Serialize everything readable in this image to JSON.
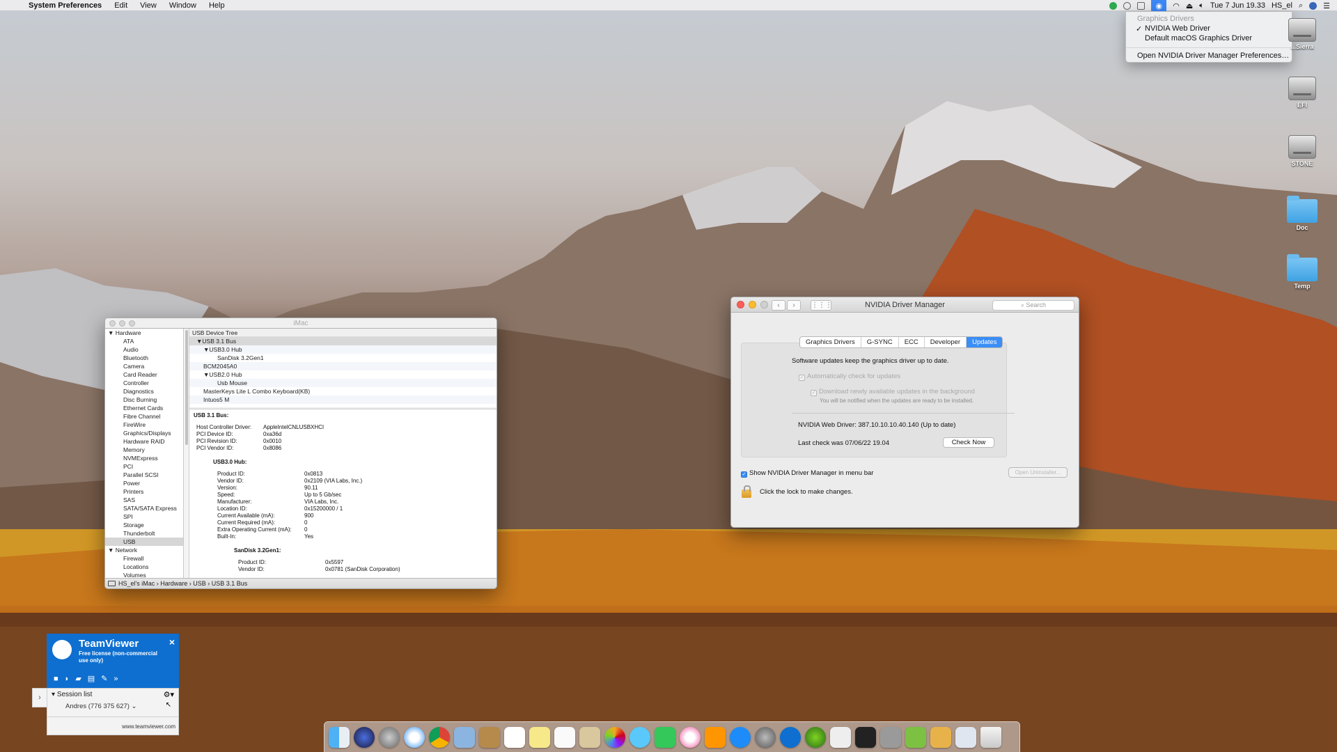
{
  "menubar": {
    "app": "System Preferences",
    "menus": [
      "Edit",
      "View",
      "Window",
      "Help"
    ],
    "clock": "Tue 7 Jun  19.33",
    "user": "HS_el"
  },
  "nvidia_menu": {
    "header": "Graphics Drivers",
    "checkmark": "✓",
    "option1": "NVIDIA Web Driver",
    "option2": "Default macOS Graphics Driver",
    "prefs": "Open NVIDIA Driver Manager Preferences…"
  },
  "desktop": {
    "icons": [
      "...Sierra",
      "EFI",
      "STONE",
      "Doc",
      "Temp"
    ]
  },
  "sysinfo": {
    "title": "iMac",
    "sidebar": [
      {
        "label": "Hardware",
        "type": "cat"
      },
      {
        "label": "ATA",
        "type": "sub"
      },
      {
        "label": "Audio",
        "type": "sub"
      },
      {
        "label": "Bluetooth",
        "type": "sub"
      },
      {
        "label": "Camera",
        "type": "sub"
      },
      {
        "label": "Card Reader",
        "type": "sub"
      },
      {
        "label": "Controller",
        "type": "sub"
      },
      {
        "label": "Diagnostics",
        "type": "sub"
      },
      {
        "label": "Disc Burning",
        "type": "sub"
      },
      {
        "label": "Ethernet Cards",
        "type": "sub"
      },
      {
        "label": "Fibre Channel",
        "type": "sub"
      },
      {
        "label": "FireWire",
        "type": "sub"
      },
      {
        "label": "Graphics/Displays",
        "type": "sub"
      },
      {
        "label": "Hardware RAID",
        "type": "sub"
      },
      {
        "label": "Memory",
        "type": "sub"
      },
      {
        "label": "NVMExpress",
        "type": "sub"
      },
      {
        "label": "PCI",
        "type": "sub"
      },
      {
        "label": "Parallel SCSI",
        "type": "sub"
      },
      {
        "label": "Power",
        "type": "sub"
      },
      {
        "label": "Printers",
        "type": "sub"
      },
      {
        "label": "SAS",
        "type": "sub"
      },
      {
        "label": "SATA/SATA Express",
        "type": "sub"
      },
      {
        "label": "SPI",
        "type": "sub"
      },
      {
        "label": "Storage",
        "type": "sub"
      },
      {
        "label": "Thunderbolt",
        "type": "sub"
      },
      {
        "label": "USB",
        "type": "sub",
        "selected": true
      },
      {
        "label": "Network",
        "type": "cat"
      },
      {
        "label": "Firewall",
        "type": "sub"
      },
      {
        "label": "Locations",
        "type": "sub"
      },
      {
        "label": "Volumes",
        "type": "sub"
      }
    ],
    "tree_header": "USB Device Tree",
    "tree": [
      {
        "label": "▼USB 3.1 Bus",
        "indent": 1,
        "selected": true
      },
      {
        "label": "▼USB3.0 Hub",
        "indent": 2
      },
      {
        "label": "SanDisk 3.2Gen1",
        "indent": 4
      },
      {
        "label": "BCM2045A0",
        "indent": 2
      },
      {
        "label": "▼USB2.0 Hub",
        "indent": 2
      },
      {
        "label": "Usb Mouse",
        "indent": 4
      },
      {
        "label": "MasterKeys Lite L Combo Keyboard(KB)",
        "indent": 2
      },
      {
        "label": "Intuos5 M",
        "indent": 2
      }
    ],
    "detail_title": "USB 3.1 Bus:",
    "bus_props": [
      [
        "Host Controller Driver:",
        "AppleIntelCNLUSBXHCI"
      ],
      [
        "PCI Device ID:",
        "0xa36d"
      ],
      [
        "PCI Revision ID:",
        "0x0010"
      ],
      [
        "PCI Vendor ID:",
        "0x8086"
      ]
    ],
    "hub_title": "USB3.0 Hub:",
    "hub_props": [
      [
        "Product ID:",
        "0x0813"
      ],
      [
        "Vendor ID:",
        "0x2109  (VIA Labs, Inc.)"
      ],
      [
        "Version:",
        "90.11"
      ],
      [
        "Speed:",
        "Up to 5 Gb/sec"
      ],
      [
        "Manufacturer:",
        "VIA Labs, Inc."
      ],
      [
        "Location ID:",
        "0x15200000 / 1"
      ],
      [
        "Current Available (mA):",
        "900"
      ],
      [
        "Current Required (mA):",
        "0"
      ],
      [
        "Extra Operating Current (mA):",
        "0"
      ],
      [
        "Built-In:",
        "Yes"
      ]
    ],
    "disk_title": "SanDisk 3.2Gen1:",
    "disk_props": [
      [
        "Product ID:",
        "0x5597"
      ],
      [
        "Vendor ID:",
        "0x0781  (SanDisk Corporation)"
      ]
    ],
    "breadcrumb": "HS_el's iMac › Hardware › USB › USB 3.1 Bus"
  },
  "nvidia": {
    "title": "NVIDIA Driver Manager",
    "search_placeholder": "Search",
    "tabs": [
      "Graphics Drivers",
      "G-SYNC",
      "ECC",
      "Developer",
      "Updates"
    ],
    "active_tab": "Updates",
    "intro": "Software updates keep the graphics driver up to date.",
    "auto_check": "Automatically check for updates",
    "auto_download": "Download newly available updates in the background",
    "notify": "You will be notified when the updates are ready to be installed.",
    "version": "NVIDIA Web Driver: 387.10.10.10.40.140 (Up to date)",
    "last_check": "Last check was 07/06/22 19.04",
    "check_now": "Check Now",
    "show_menu": "Show NVIDIA Driver Manager in menu bar",
    "uninstall": "Open Uninstaller...",
    "lock_text": "Click the lock to make changes."
  },
  "teamviewer": {
    "brand": "TeamViewer",
    "license": "Free license (non-commercial use only)",
    "session_list": "Session list",
    "contact": "Andres (776 375 627) ⌄",
    "website": "www.teamviewer.com"
  },
  "colors": {
    "accent": "#3a8ef6",
    "teamviewer": "#0e6fd0"
  }
}
